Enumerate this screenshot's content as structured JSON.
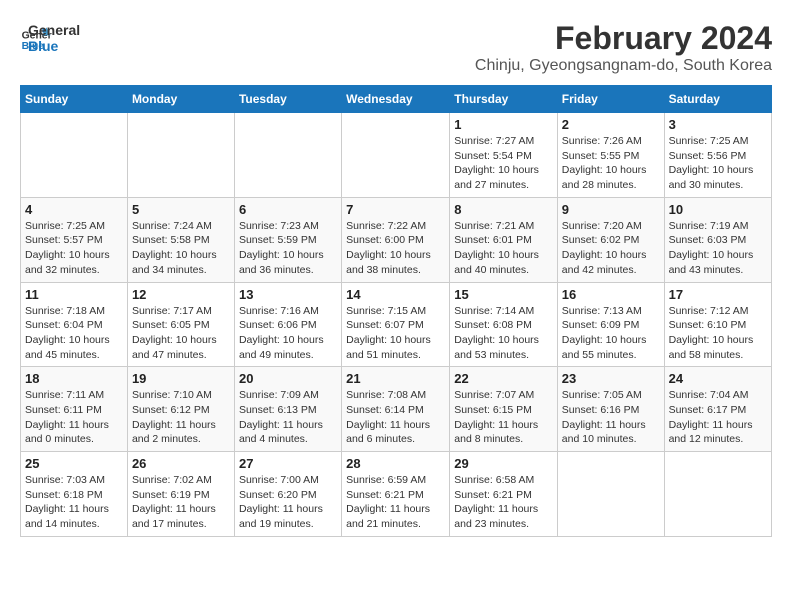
{
  "logo": {
    "line1": "General",
    "line2": "Blue"
  },
  "title": "February 2024",
  "subtitle": "Chinju, Gyeongsangnam-do, South Korea",
  "days_of_week": [
    "Sunday",
    "Monday",
    "Tuesday",
    "Wednesday",
    "Thursday",
    "Friday",
    "Saturday"
  ],
  "weeks": [
    [
      {
        "day": "",
        "info": ""
      },
      {
        "day": "",
        "info": ""
      },
      {
        "day": "",
        "info": ""
      },
      {
        "day": "",
        "info": ""
      },
      {
        "day": "1",
        "info": "Sunrise: 7:27 AM\nSunset: 5:54 PM\nDaylight: 10 hours and 27 minutes."
      },
      {
        "day": "2",
        "info": "Sunrise: 7:26 AM\nSunset: 5:55 PM\nDaylight: 10 hours and 28 minutes."
      },
      {
        "day": "3",
        "info": "Sunrise: 7:25 AM\nSunset: 5:56 PM\nDaylight: 10 hours and 30 minutes."
      }
    ],
    [
      {
        "day": "4",
        "info": "Sunrise: 7:25 AM\nSunset: 5:57 PM\nDaylight: 10 hours and 32 minutes."
      },
      {
        "day": "5",
        "info": "Sunrise: 7:24 AM\nSunset: 5:58 PM\nDaylight: 10 hours and 34 minutes."
      },
      {
        "day": "6",
        "info": "Sunrise: 7:23 AM\nSunset: 5:59 PM\nDaylight: 10 hours and 36 minutes."
      },
      {
        "day": "7",
        "info": "Sunrise: 7:22 AM\nSunset: 6:00 PM\nDaylight: 10 hours and 38 minutes."
      },
      {
        "day": "8",
        "info": "Sunrise: 7:21 AM\nSunset: 6:01 PM\nDaylight: 10 hours and 40 minutes."
      },
      {
        "day": "9",
        "info": "Sunrise: 7:20 AM\nSunset: 6:02 PM\nDaylight: 10 hours and 42 minutes."
      },
      {
        "day": "10",
        "info": "Sunrise: 7:19 AM\nSunset: 6:03 PM\nDaylight: 10 hours and 43 minutes."
      }
    ],
    [
      {
        "day": "11",
        "info": "Sunrise: 7:18 AM\nSunset: 6:04 PM\nDaylight: 10 hours and 45 minutes."
      },
      {
        "day": "12",
        "info": "Sunrise: 7:17 AM\nSunset: 6:05 PM\nDaylight: 10 hours and 47 minutes."
      },
      {
        "day": "13",
        "info": "Sunrise: 7:16 AM\nSunset: 6:06 PM\nDaylight: 10 hours and 49 minutes."
      },
      {
        "day": "14",
        "info": "Sunrise: 7:15 AM\nSunset: 6:07 PM\nDaylight: 10 hours and 51 minutes."
      },
      {
        "day": "15",
        "info": "Sunrise: 7:14 AM\nSunset: 6:08 PM\nDaylight: 10 hours and 53 minutes."
      },
      {
        "day": "16",
        "info": "Sunrise: 7:13 AM\nSunset: 6:09 PM\nDaylight: 10 hours and 55 minutes."
      },
      {
        "day": "17",
        "info": "Sunrise: 7:12 AM\nSunset: 6:10 PM\nDaylight: 10 hours and 58 minutes."
      }
    ],
    [
      {
        "day": "18",
        "info": "Sunrise: 7:11 AM\nSunset: 6:11 PM\nDaylight: 11 hours and 0 minutes."
      },
      {
        "day": "19",
        "info": "Sunrise: 7:10 AM\nSunset: 6:12 PM\nDaylight: 11 hours and 2 minutes."
      },
      {
        "day": "20",
        "info": "Sunrise: 7:09 AM\nSunset: 6:13 PM\nDaylight: 11 hours and 4 minutes."
      },
      {
        "day": "21",
        "info": "Sunrise: 7:08 AM\nSunset: 6:14 PM\nDaylight: 11 hours and 6 minutes."
      },
      {
        "day": "22",
        "info": "Sunrise: 7:07 AM\nSunset: 6:15 PM\nDaylight: 11 hours and 8 minutes."
      },
      {
        "day": "23",
        "info": "Sunrise: 7:05 AM\nSunset: 6:16 PM\nDaylight: 11 hours and 10 minutes."
      },
      {
        "day": "24",
        "info": "Sunrise: 7:04 AM\nSunset: 6:17 PM\nDaylight: 11 hours and 12 minutes."
      }
    ],
    [
      {
        "day": "25",
        "info": "Sunrise: 7:03 AM\nSunset: 6:18 PM\nDaylight: 11 hours and 14 minutes."
      },
      {
        "day": "26",
        "info": "Sunrise: 7:02 AM\nSunset: 6:19 PM\nDaylight: 11 hours and 17 minutes."
      },
      {
        "day": "27",
        "info": "Sunrise: 7:00 AM\nSunset: 6:20 PM\nDaylight: 11 hours and 19 minutes."
      },
      {
        "day": "28",
        "info": "Sunrise: 6:59 AM\nSunset: 6:21 PM\nDaylight: 11 hours and 21 minutes."
      },
      {
        "day": "29",
        "info": "Sunrise: 6:58 AM\nSunset: 6:21 PM\nDaylight: 11 hours and 23 minutes."
      },
      {
        "day": "",
        "info": ""
      },
      {
        "day": "",
        "info": ""
      }
    ]
  ]
}
